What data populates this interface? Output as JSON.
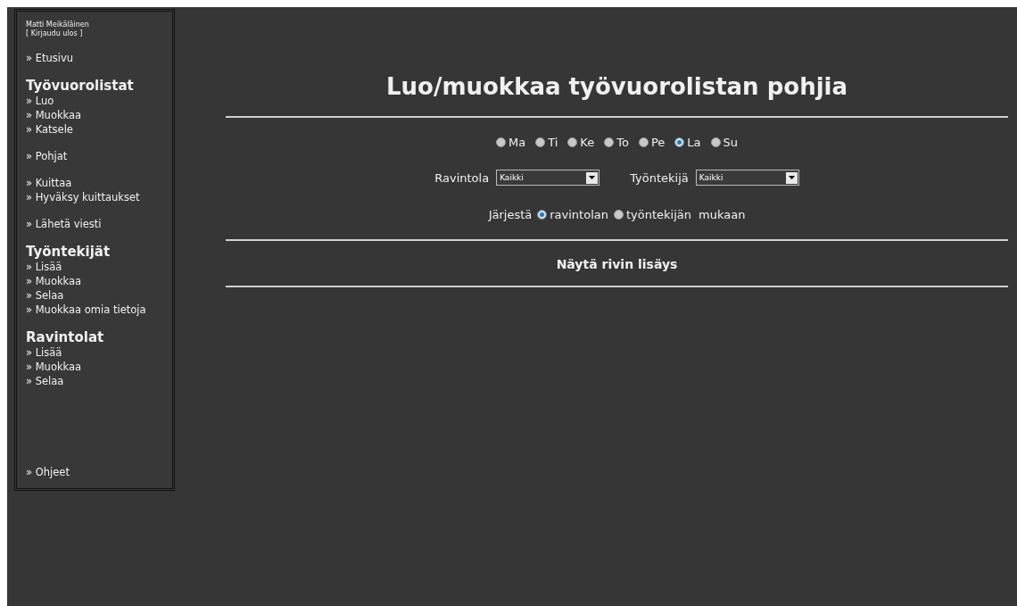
{
  "user": {
    "name": "Matti Meikäläinen",
    "logout": "[ Kirjaudu ulos ]"
  },
  "sidebar": {
    "groups": [
      {
        "items": [
          "» Etusivu"
        ]
      },
      {
        "heading": "Työvuorolistat",
        "items": [
          "» Luo",
          "» Muokkaa",
          "» Katsele"
        ]
      },
      {
        "items": [
          "» Pohjat"
        ]
      },
      {
        "items": [
          "» Kuittaa",
          "» Hyväksy kuittaukset"
        ]
      },
      {
        "items": [
          "» Lähetä viesti"
        ]
      },
      {
        "heading": "Työntekijät",
        "items": [
          "» Lisää",
          "» Muokkaa",
          "» Selaa",
          "» Muokkaa omia tietoja"
        ]
      },
      {
        "heading": "Ravintolat",
        "items": [
          "» Lisää",
          "» Muokkaa",
          "» Selaa"
        ]
      }
    ],
    "footer": "» Ohjeet"
  },
  "title": "Luo/muokkaa työvuorolistan pohjia",
  "days": [
    {
      "label": "Ma",
      "selected": false
    },
    {
      "label": "Ti",
      "selected": false
    },
    {
      "label": "Ke",
      "selected": false
    },
    {
      "label": "To",
      "selected": false
    },
    {
      "label": "Pe",
      "selected": false
    },
    {
      "label": "La",
      "selected": true
    },
    {
      "label": "Su",
      "selected": false
    }
  ],
  "filters": [
    {
      "label": "Ravintola",
      "value": "Kaikki"
    },
    {
      "label": "Työntekijä",
      "value": "Kaikki"
    }
  ],
  "sort": {
    "label": "Järjestä",
    "options": [
      {
        "label": "ravintolan",
        "selected": true
      },
      {
        "label": "työntekijän",
        "selected": false
      }
    ],
    "suffix": "mukaan"
  },
  "toggle": "Näytä rivin lisäys"
}
